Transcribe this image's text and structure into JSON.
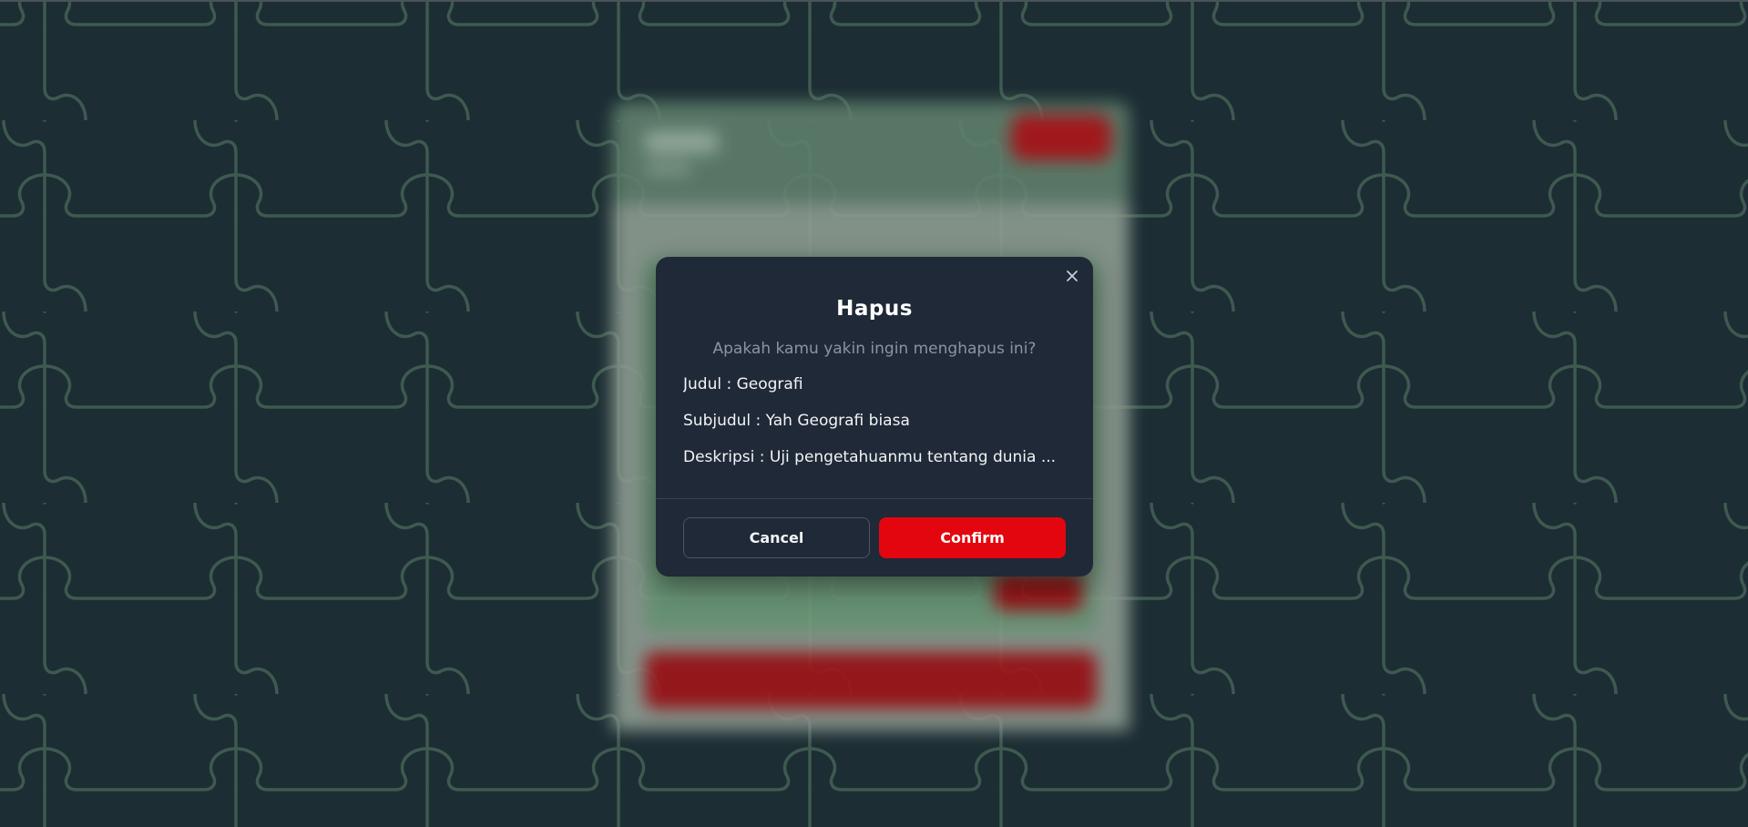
{
  "modal": {
    "title": "Hapus",
    "question": "Apakah kamu yakin ingin menghapus ini?",
    "details": {
      "judul": "Judul : Geografi",
      "subjudul": "Subjudul : Yah Geografi biasa",
      "deskripsi": "Deskripsi : Uji pengetahuanmu tentang dunia ..."
    },
    "cancel_label": "Cancel",
    "confirm_label": "Confirm",
    "close_icon": "close-icon"
  },
  "colors": {
    "background": "#1c2d33",
    "pattern_line": "#3e5a50",
    "modal_bg": "#1f2937",
    "confirm": "#e3060f",
    "muted_text": "#8a94a6"
  }
}
